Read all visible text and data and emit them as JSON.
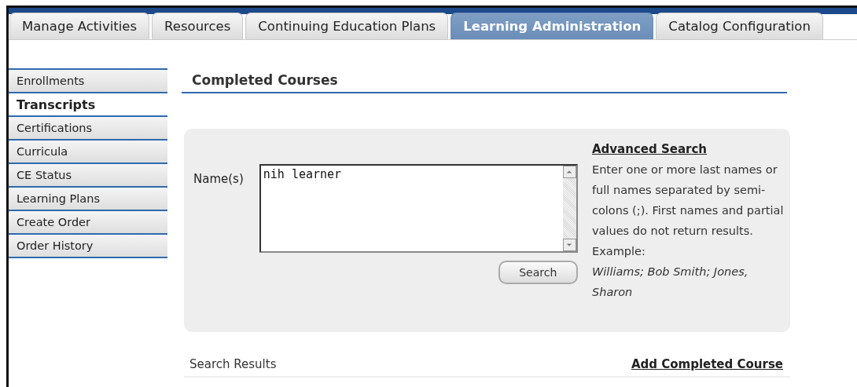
{
  "tabs": [
    {
      "label": "Manage Activities",
      "selected": false
    },
    {
      "label": "Resources",
      "selected": false
    },
    {
      "label": "Continuing Education Plans",
      "selected": false
    },
    {
      "label": "Learning Administration",
      "selected": true
    },
    {
      "label": "Catalog Configuration",
      "selected": false
    }
  ],
  "sidebar": {
    "items": [
      {
        "label": "Enrollments",
        "selected": false
      },
      {
        "label": "Transcripts",
        "selected": true
      },
      {
        "label": "Certifications",
        "selected": false
      },
      {
        "label": "Curricula",
        "selected": false
      },
      {
        "label": "CE Status",
        "selected": false
      },
      {
        "label": "Learning Plans",
        "selected": false
      },
      {
        "label": "Create Order",
        "selected": false
      },
      {
        "label": "Order History",
        "selected": false
      }
    ]
  },
  "page_title": "Completed Courses",
  "search_panel": {
    "name_label": "Name(s)",
    "names_field": {
      "value": "nih learner"
    },
    "search_button": "Search",
    "advanced_search_link": "Advanced Search",
    "help_text": "Enter one or more last names or full names separated by semi-colons (;). First names and partial values do not return results.",
    "example_label": "Example:",
    "example_text": "Williams; Bob Smith; Jones, Sharon"
  },
  "results": {
    "title": "Search Results",
    "add_link": "Add Completed Course"
  }
}
